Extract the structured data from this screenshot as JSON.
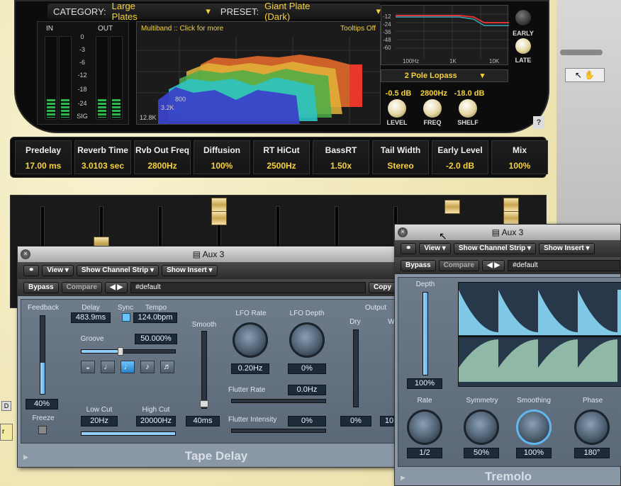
{
  "space_designer": {
    "category_label": "CATEGORY:",
    "category_value": "Large Plates",
    "preset_label": "PRESET:",
    "preset_value": "Giant Plate (Dark)",
    "in_label": "IN",
    "out_label": "OUT",
    "scale": [
      "0",
      "-3",
      "-6",
      "-12",
      "-18",
      "-24",
      "SIG"
    ],
    "multiband_text": "Multiband :: Click for more",
    "tooltips_text": "Tooltips Off",
    "ir_freqs": [
      "12.8K",
      "3.2K",
      "800"
    ],
    "eq_db": [
      "-12",
      "-24",
      "-36",
      "-48",
      "-60"
    ],
    "eq_freqs": [
      "100Hz",
      "1K",
      "10K"
    ],
    "filter_mode": "2 Pole Lopass",
    "level_value": "-0.5 dB",
    "freq_value": "2800Hz",
    "shelf_value": "-18.0 dB",
    "level_label": "LEVEL",
    "freq_label": "FREQ",
    "shelf_label": "SHELF",
    "early_label": "EARLY",
    "late_label": "LATE",
    "help": "?",
    "params": [
      {
        "label": "Predelay",
        "value": "17.00 ms"
      },
      {
        "label": "Reverb Time",
        "value": "3.0103 sec"
      },
      {
        "label": "Rvb Out Freq",
        "value": "2800Hz"
      },
      {
        "label": "Diffusion",
        "value": "100%"
      },
      {
        "label": "RT HiCut",
        "value": "2500Hz"
      },
      {
        "label": "BassRT",
        "value": "1.50x"
      },
      {
        "label": "Tail Width",
        "value": "Stereo"
      },
      {
        "label": "Early Level",
        "value": "-2.0 dB"
      },
      {
        "label": "Mix",
        "value": "100%"
      }
    ]
  },
  "tape": {
    "title": "Aux 3",
    "view": "View",
    "show_channel_strip": "Show Channel Strip",
    "show_insert": "Show Insert",
    "bypass": "Bypass",
    "compare": "Compare",
    "preset": "#default",
    "copy": "Copy",
    "feedback": "Feedback",
    "feedback_value": "40%",
    "feedback_level": 0.4,
    "freeze": "Freeze",
    "delay": "Delay",
    "delay_value": "483.9ms",
    "sync": "Sync",
    "tempo": "Tempo",
    "tempo_value": "124.0bpm",
    "groove": "Groove",
    "groove_value": "50.000%",
    "low_cut": "Low Cut",
    "low_cut_value": "20Hz",
    "high_cut": "High Cut",
    "high_cut_value": "20000Hz",
    "smooth": "Smooth",
    "smooth_value": "40ms",
    "lfo_rate": "LFO Rate",
    "lfo_rate_value": "0.20Hz",
    "lfo_depth": "LFO Depth",
    "lfo_depth_value": "0%",
    "flutter_rate": "Flutter Rate",
    "flutter_rate_value": "0.0Hz",
    "flutter_intensity": "Flutter Intensity",
    "flutter_intensity_value": "0%",
    "output": "Output",
    "dry": "Dry",
    "dry_value": "0%",
    "wet_partial": "W",
    "wet_value_partial": "10",
    "name": "Tape Delay"
  },
  "tremolo": {
    "title": "Aux 3",
    "view": "View",
    "show_channel_strip": "Show Channel Strip",
    "show_insert": "Show Insert",
    "bypass": "Bypass",
    "compare": "Compare",
    "preset": "#default",
    "depth": "Depth",
    "depth_value": "100%",
    "depth_level": 1.0,
    "rate": "Rate",
    "rate_value": "1/2",
    "symmetry": "Symmetry",
    "symmetry_value": "50%",
    "smoothing": "Smoothing",
    "smoothing_value": "100%",
    "phase": "Phase",
    "phase_value": "180°",
    "name": "Tremolo"
  },
  "left_edge": {
    "d": "D",
    "r": "r"
  }
}
